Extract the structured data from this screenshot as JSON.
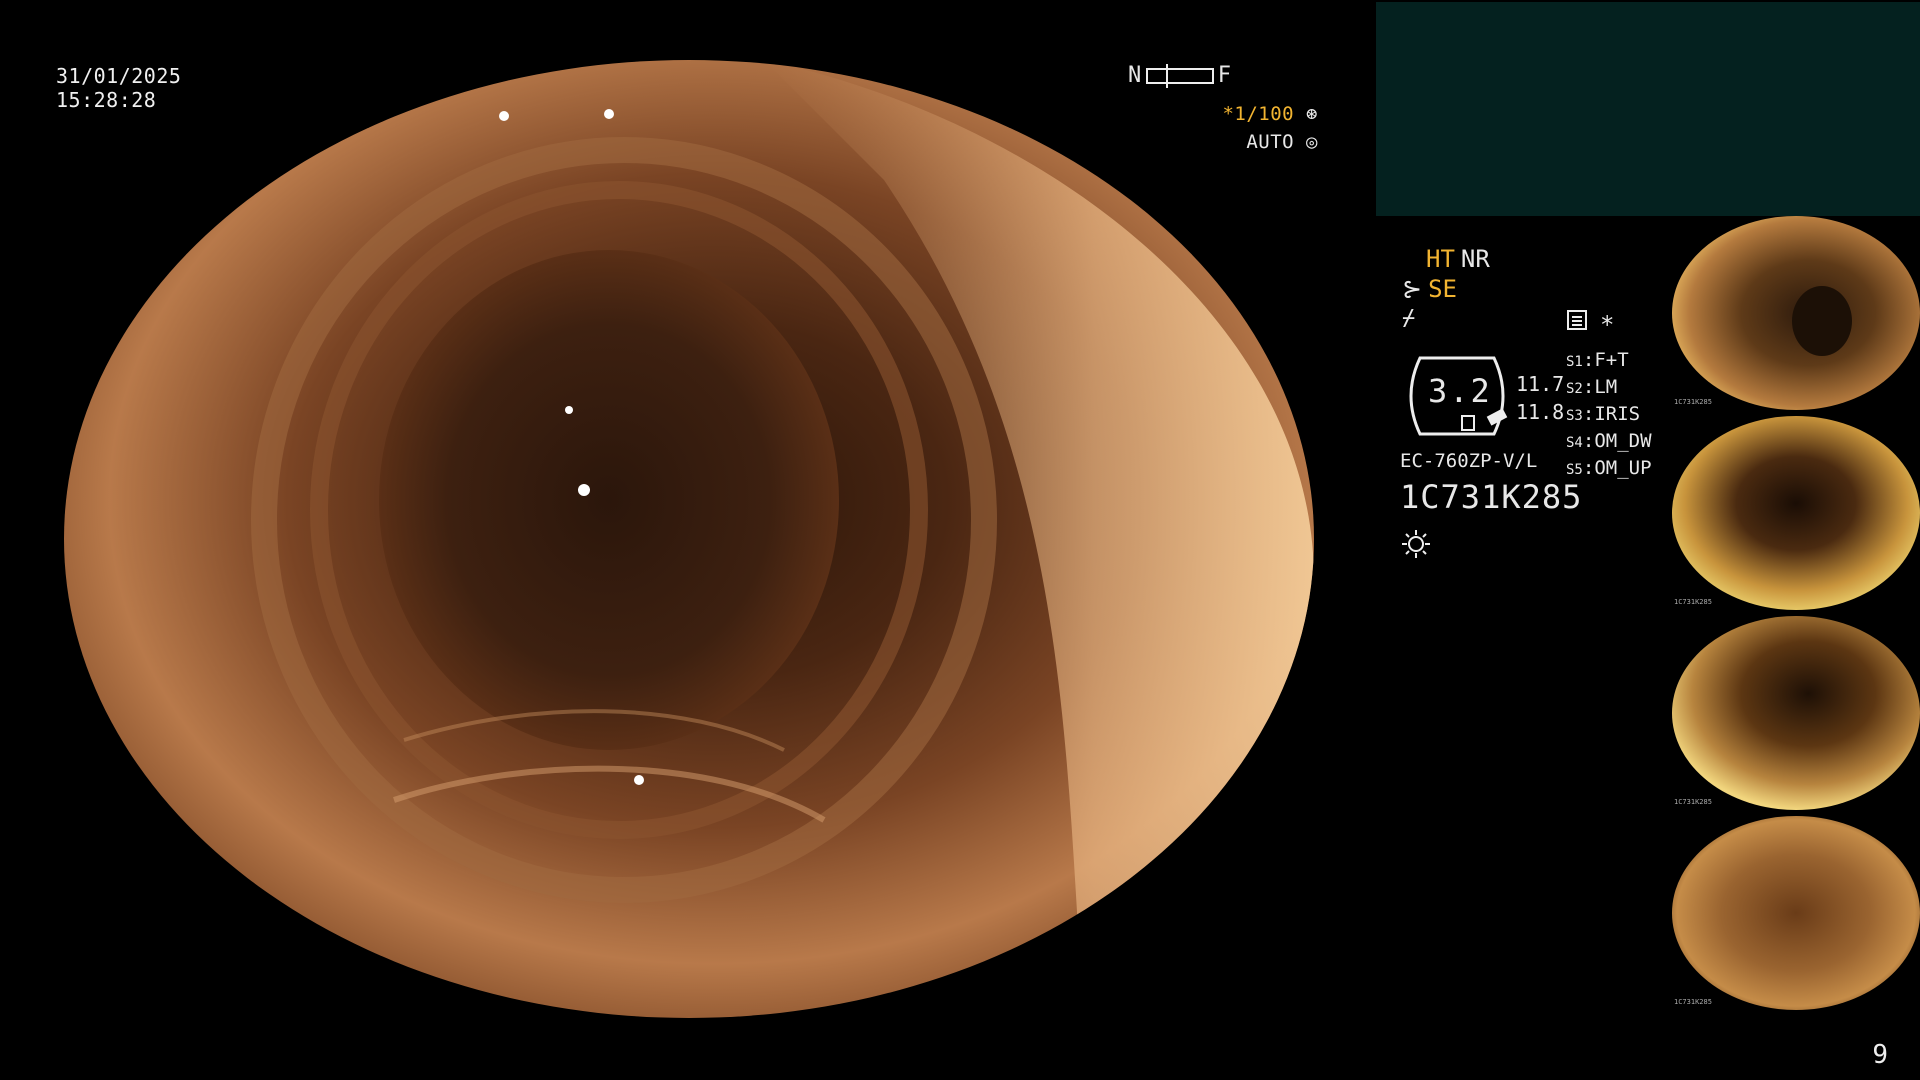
{
  "datetime": {
    "date": "31/01/2025",
    "time": "15:28:28"
  },
  "nf_scale": {
    "near_label": "N",
    "far_label": "F"
  },
  "shutter": {
    "speed": "*1/100",
    "mode": "AUTO"
  },
  "modes": {
    "ht": "HT",
    "nr": "NR",
    "se": "SE"
  },
  "gauge": {
    "value": "3.2",
    "readout_1": "11.7",
    "readout_2": "11.8"
  },
  "scope": {
    "model": "EC-760ZP-V/L",
    "serial": "1C731K285"
  },
  "presets": [
    {
      "key": "S1",
      "value": "F+T"
    },
    {
      "key": "S2",
      "value": "LM"
    },
    {
      "key": "S3",
      "value": "IRIS"
    },
    {
      "key": "S4",
      "value": "OM_DW"
    },
    {
      "key": "S5",
      "value": "OM_UP"
    }
  ],
  "thumbnails": [
    {
      "label": "1C731K285"
    },
    {
      "label": "1C731K285"
    },
    {
      "label": "1C731K285"
    },
    {
      "label": "1C731K285"
    }
  ],
  "page_number": "9",
  "colors": {
    "accent": "#f2b431",
    "panel": "#04211f"
  },
  "icons": [
    "shutter-icon",
    "auto-iris-icon",
    "scope-bend-icon",
    "lightning-icon",
    "memo-icon",
    "asterisk-icon",
    "light-source-icon"
  ]
}
